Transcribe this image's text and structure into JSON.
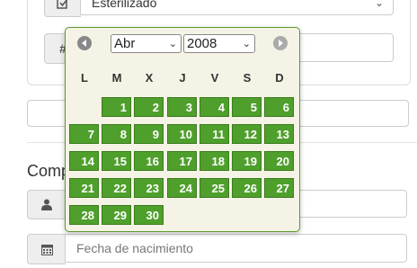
{
  "form": {
    "sterilized_value": "Esterilizado",
    "hash_symbol": "#",
    "section_heading": "Comp",
    "dob_placeholder": "Fecha de nacimiento"
  },
  "datepicker": {
    "month": "Abr",
    "year": "2008",
    "weekdays": [
      "L",
      "M",
      "X",
      "J",
      "V",
      "S",
      "D"
    ],
    "weeks": [
      [
        "",
        "1",
        "2",
        "3",
        "4",
        "5",
        "6"
      ],
      [
        "7",
        "8",
        "9",
        "10",
        "11",
        "12",
        "13"
      ],
      [
        "14",
        "15",
        "16",
        "17",
        "18",
        "19",
        "20"
      ],
      [
        "21",
        "22",
        "23",
        "24",
        "25",
        "26",
        "27"
      ],
      [
        "28",
        "29",
        "30",
        "",
        "",
        "",
        ""
      ]
    ],
    "colors": {
      "day_bg": "#4e9f2b",
      "panel_bg": "#f5f3e5",
      "border": "#5c9a2c"
    }
  }
}
